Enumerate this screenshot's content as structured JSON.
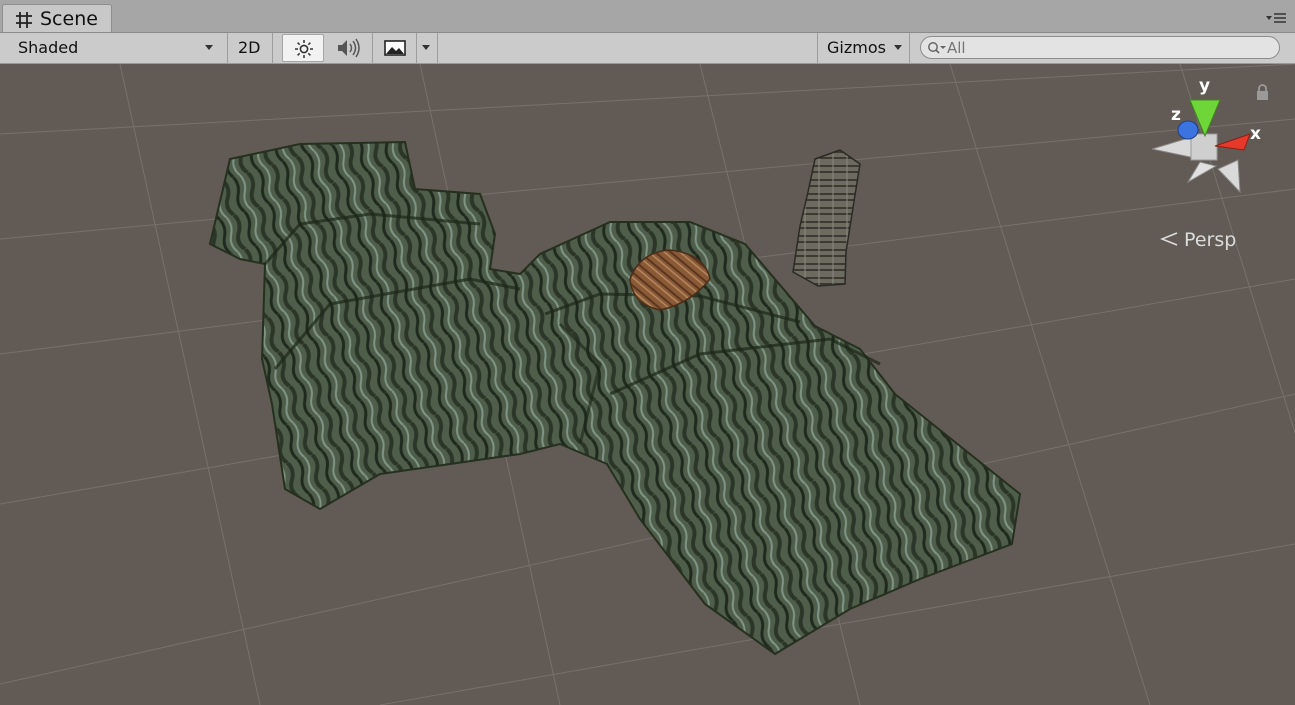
{
  "window": {
    "tab_label": "Scene",
    "tab_icon": "grid-hash-icon",
    "menu_icon": "tab-options-icon"
  },
  "toolbar": {
    "draw_mode": "Shaded",
    "mode_2d": "2D",
    "lighting_icon": "sun-icon",
    "audio_icon": "speaker-icon",
    "effects_icon": "image-icon",
    "gizmos_label": "Gizmos",
    "search_placeholder": "All",
    "search_value": ""
  },
  "scene_gizmo": {
    "axis_y": "y",
    "axis_z": "z",
    "axis_x": "x",
    "projection_label": "Persp",
    "colors": {
      "x": "#e53a2a",
      "y": "#6fd63a",
      "z": "#3b73e0"
    }
  },
  "viewport": {
    "background": "#625b55",
    "grid_color": "#7a746e"
  }
}
